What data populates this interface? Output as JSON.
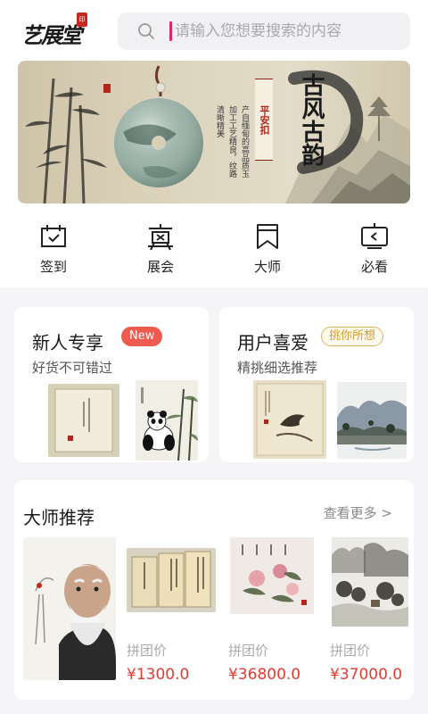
{
  "header": {
    "logo_text": "艺展堂",
    "logo_seal": "印",
    "search_placeholder": "请输入您想要搜索的内容"
  },
  "banner": {
    "title": "古风古韵",
    "seal_text": "平安扣",
    "copy_lines": [
      "产自缅甸的高品质玉",
      "加工工艺精良，纹路",
      "清晰精美"
    ],
    "slide_count": 4,
    "active_slide": 2
  },
  "quicknav": [
    {
      "label": "签到",
      "icon": "calendar-icon"
    },
    {
      "label": "展会",
      "icon": "exhibition-icon"
    },
    {
      "label": "大师",
      "icon": "bookmark-icon"
    },
    {
      "label": "必看",
      "icon": "tv-icon"
    }
  ],
  "promos": [
    {
      "title": "新人专享",
      "badge": "New",
      "subtitle": "好货不可错过"
    },
    {
      "title": "用户喜爱",
      "badge": "挑你所想",
      "subtitle": "精挑细选推荐"
    }
  ],
  "masters": {
    "title": "大师推荐",
    "more_label": "查看更多 >",
    "items": [
      {
        "price_label": "拼团价",
        "price": "¥1300.0"
      },
      {
        "price_label": "拼团价",
        "price": "¥36800.0"
      },
      {
        "price_label": "拼团价",
        "price": "¥37000.0"
      }
    ]
  },
  "colors": {
    "accent_red": "#e33b2e",
    "badge_gold": "#d59a2a",
    "cursor_pink": "#e4246a"
  }
}
